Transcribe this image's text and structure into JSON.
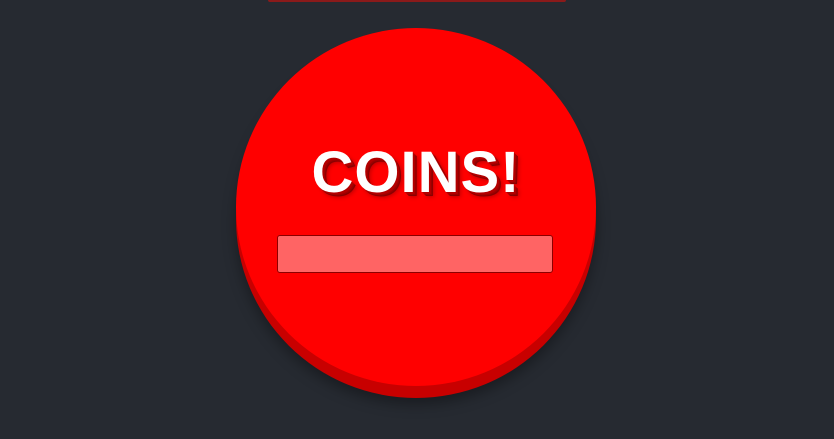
{
  "coin": {
    "title": "COINS!",
    "input_value": "",
    "input_placeholder": ""
  },
  "colors": {
    "background": "#262a31",
    "coin_face": "#ff0000",
    "coin_rim": "#c80000",
    "input_fill": "#ff6464",
    "input_border": "#8b0000",
    "top_bar": "#8a1a1a"
  }
}
